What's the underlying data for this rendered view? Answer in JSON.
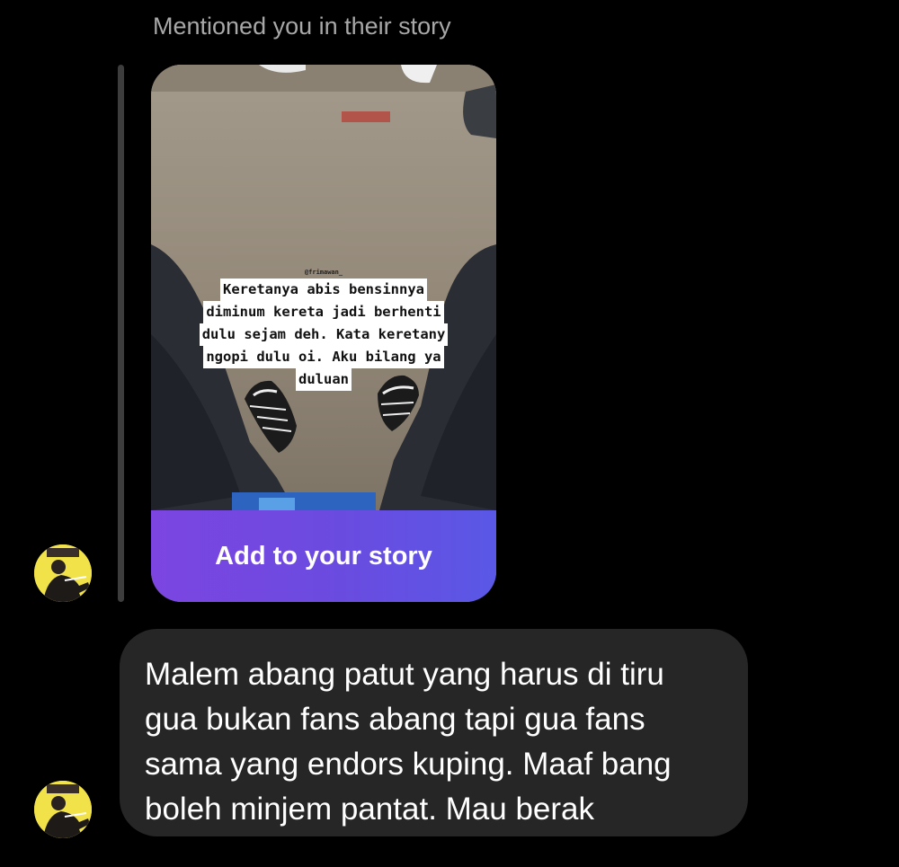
{
  "thread": {
    "mention_label": "Mentioned you in their story"
  },
  "story": {
    "username_tag": "@frimawan_",
    "caption_lines": [
      "Keretanya abis bensinnya",
      "diminum kereta jadi berhenti",
      "dulu sejam deh. Kata keretany",
      "ngopi dulu oi. Aku bilang ya",
      "duluan"
    ],
    "add_button_label": "Add to your story",
    "button_gradient": [
      "#7c45e1",
      "#5a58e6"
    ]
  },
  "message": {
    "lines": [
      "Malem abang patut yang harus di tiru",
      "gua bukan fans abang tapi gua fans",
      "sama yang endors kuping. Maaf bang",
      "boleh minjem pantat. Mau berak"
    ]
  },
  "colors": {
    "background": "#000000",
    "bubble": "#262626",
    "muted_text": "#a8a8a8",
    "avatar_bg": "#f2e24a"
  }
}
